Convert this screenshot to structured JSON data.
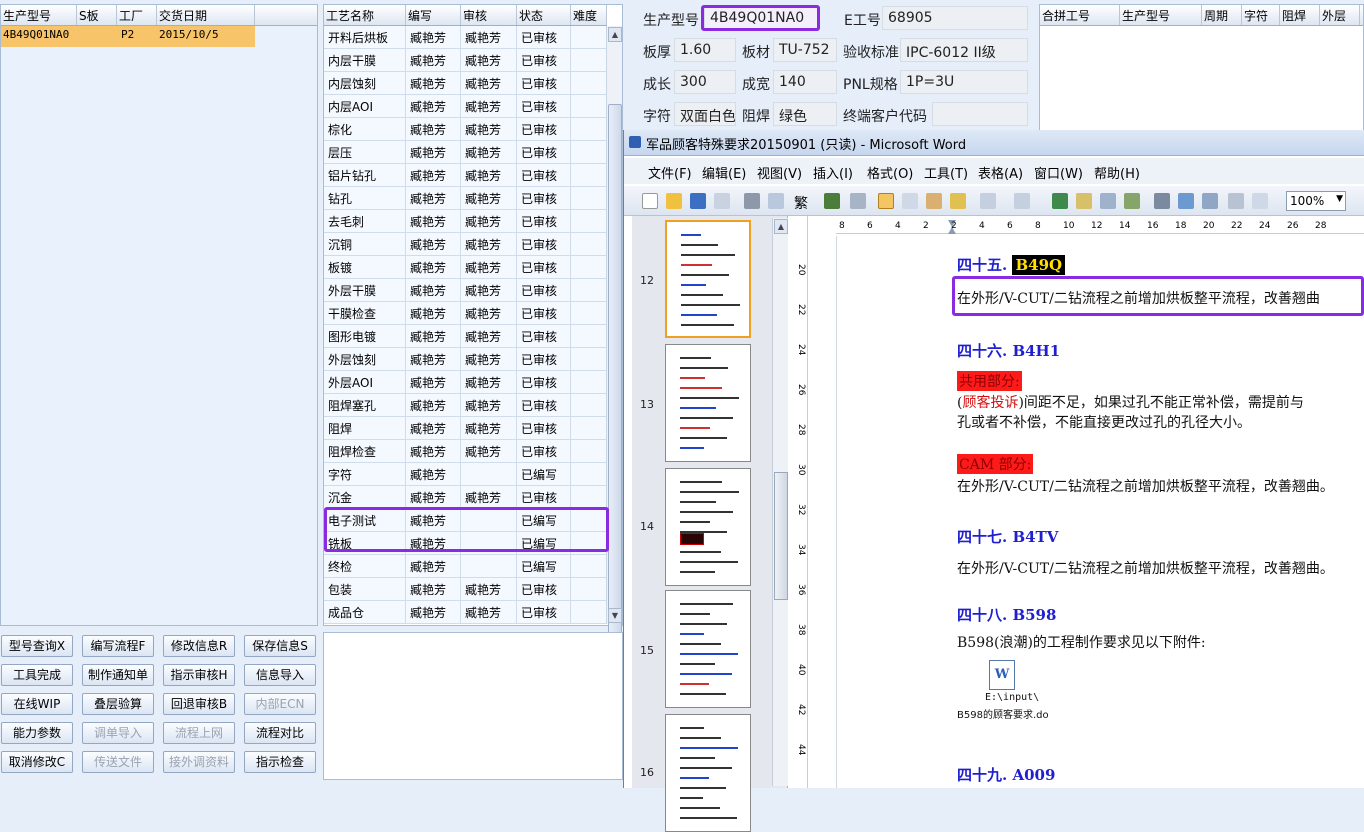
{
  "orders": {
    "headers": [
      "生产型号",
      "S板",
      "工厂",
      "交货日期"
    ],
    "rows": [
      {
        "model": "4B49Q01NA0",
        "s": "",
        "factory": "P2",
        "date": "2015/10/5"
      }
    ]
  },
  "process": {
    "headers": [
      "工艺名称",
      "编写",
      "审核",
      "状态",
      "难度"
    ],
    "rows": [
      {
        "name": "开料后烘板",
        "writer": "臧艳芳",
        "reviewer": "臧艳芳",
        "status": "已审核"
      },
      {
        "name": "内层干膜",
        "writer": "臧艳芳",
        "reviewer": "臧艳芳",
        "status": "已审核"
      },
      {
        "name": "内层蚀刻",
        "writer": "臧艳芳",
        "reviewer": "臧艳芳",
        "status": "已审核"
      },
      {
        "name": "内层AOI",
        "writer": "臧艳芳",
        "reviewer": "臧艳芳",
        "status": "已审核"
      },
      {
        "name": "棕化",
        "writer": "臧艳芳",
        "reviewer": "臧艳芳",
        "status": "已审核"
      },
      {
        "name": "层压",
        "writer": "臧艳芳",
        "reviewer": "臧艳芳",
        "status": "已审核"
      },
      {
        "name": "铝片钻孔",
        "writer": "臧艳芳",
        "reviewer": "臧艳芳",
        "status": "已审核"
      },
      {
        "name": "钻孔",
        "writer": "臧艳芳",
        "reviewer": "臧艳芳",
        "status": "已审核"
      },
      {
        "name": "去毛刺",
        "writer": "臧艳芳",
        "reviewer": "臧艳芳",
        "status": "已审核"
      },
      {
        "name": "沉铜",
        "writer": "臧艳芳",
        "reviewer": "臧艳芳",
        "status": "已审核"
      },
      {
        "name": "板镀",
        "writer": "臧艳芳",
        "reviewer": "臧艳芳",
        "status": "已审核"
      },
      {
        "name": "外层干膜",
        "writer": "臧艳芳",
        "reviewer": "臧艳芳",
        "status": "已审核"
      },
      {
        "name": "干膜检查",
        "writer": "臧艳芳",
        "reviewer": "臧艳芳",
        "status": "已审核"
      },
      {
        "name": "图形电镀",
        "writer": "臧艳芳",
        "reviewer": "臧艳芳",
        "status": "已审核"
      },
      {
        "name": "外层蚀刻",
        "writer": "臧艳芳",
        "reviewer": "臧艳芳",
        "status": "已审核"
      },
      {
        "name": "外层AOI",
        "writer": "臧艳芳",
        "reviewer": "臧艳芳",
        "status": "已审核"
      },
      {
        "name": "阻焊塞孔",
        "writer": "臧艳芳",
        "reviewer": "臧艳芳",
        "status": "已审核"
      },
      {
        "name": "阻焊",
        "writer": "臧艳芳",
        "reviewer": "臧艳芳",
        "status": "已审核"
      },
      {
        "name": "阻焊检查",
        "writer": "臧艳芳",
        "reviewer": "臧艳芳",
        "status": "已审核"
      },
      {
        "name": "字符",
        "writer": "臧艳芳",
        "reviewer": "",
        "status": "已编写"
      },
      {
        "name": "沉金",
        "writer": "臧艳芳",
        "reviewer": "臧艳芳",
        "status": "已审核"
      },
      {
        "name": "电子测试",
        "writer": "臧艳芳",
        "reviewer": "",
        "status": "已编写"
      },
      {
        "name": "铣板",
        "writer": "臧艳芳",
        "reviewer": "",
        "status": "已编写"
      },
      {
        "name": "终检",
        "writer": "臧艳芳",
        "reviewer": "",
        "status": "已编写"
      },
      {
        "name": "包装",
        "writer": "臧艳芳",
        "reviewer": "臧艳芳",
        "status": "已审核"
      },
      {
        "name": "成品仓",
        "writer": "臧艳芳",
        "reviewer": "臧艳芳",
        "status": "已审核"
      }
    ]
  },
  "info": {
    "model_label": "生产型号",
    "model_value": "4B49Q01NA0",
    "e_label": "E工号",
    "e_value": "68905",
    "thick_label": "板厚",
    "thick_value": "1.60",
    "mat_label": "板材",
    "mat_value": "TU-752",
    "std_label": "验收标准",
    "std_value": "IPC-6012 II级",
    "len_label": "成长",
    "len_value": "300",
    "wid_label": "成宽",
    "wid_value": "140",
    "pnl_label": "PNL规格",
    "pnl_value": "1P=3U",
    "char_label": "字符",
    "char_value": "双面白色",
    "mask_label": "阻焊",
    "mask_value": "绿色",
    "cust_label": "终端客户代码",
    "cust_value": ""
  },
  "combo": {
    "headers": [
      "合拼工号",
      "生产型号",
      "周期",
      "字符",
      "阻焊",
      "外层"
    ]
  },
  "buttons": [
    [
      "型号查询X",
      "编写流程F",
      "修改信息R",
      "保存信息S"
    ],
    [
      "工具完成",
      "制作通知单",
      "指示审核H",
      "信息导入"
    ],
    [
      "在线WIP",
      "叠层验算",
      "回退审核B",
      "内部ECN"
    ],
    [
      "能力参数",
      "调单导入",
      "流程上网",
      "流程对比"
    ],
    [
      "取消修改C",
      "传送文件",
      "接外调资料",
      "指示检查"
    ]
  ],
  "word": {
    "title": "军品顾客特殊要求20150901 (只读) - Microsoft Word",
    "menu": [
      "文件(F)",
      "编辑(E)",
      "视图(V)",
      "插入(I)",
      "格式(O)",
      "工具(T)",
      "表格(A)",
      "窗口(W)",
      "帮助(H)"
    ],
    "zoom": "100%",
    "page_numbers": [
      "12",
      "13",
      "14",
      "15",
      "16"
    ],
    "ruler_h": [
      "8",
      "6",
      "4",
      "2",
      "2",
      "4",
      "6",
      "8",
      "10",
      "12",
      "14",
      "16",
      "18",
      "20",
      "22",
      "24",
      "26",
      "28"
    ],
    "ruler_v": [
      "20",
      "22",
      "24",
      "26",
      "28",
      "30",
      "32",
      "34",
      "36",
      "38",
      "40",
      "42",
      "44"
    ],
    "colors": {
      "heading": "#1f1fd0",
      "highlight_box": "#8a2be2",
      "red_label_bg": "#ff1a1a",
      "selected_row": "#f7c46a"
    },
    "doc": {
      "h45_prefix": "四十五.",
      "h45_code": "B49Q",
      "p45": "在外形/V-CUT/二钻流程之前增加烘板整平流程，改善翘曲",
      "h46": "四十六. B4H1",
      "shared_label": "共用部分:",
      "complaint_open": "(",
      "complaint": "顾客投诉",
      "p46a_rest": ")间距不足，如果过孔不能正常补偿，需提前与",
      "p46b": "孔或者不补偿，不能直接更改过孔的孔径大小。",
      "cam_label": "CAM 部分:",
      "p46c": "在外形/V-CUT/二钻流程之前增加烘板整平流程，改善翘曲。",
      "h47": "四十七. B4TV",
      "p47": "在外形/V-CUT/二钻流程之前增加烘板整平流程，改善翘曲。",
      "h48": "四十八. B598",
      "p48": "B598(浪潮)的工程制作要求见以下附件:",
      "attach_path": "E:\\input\\",
      "attach_name": "B598的顾客要求.do",
      "h49": "四十九. A009"
    }
  }
}
